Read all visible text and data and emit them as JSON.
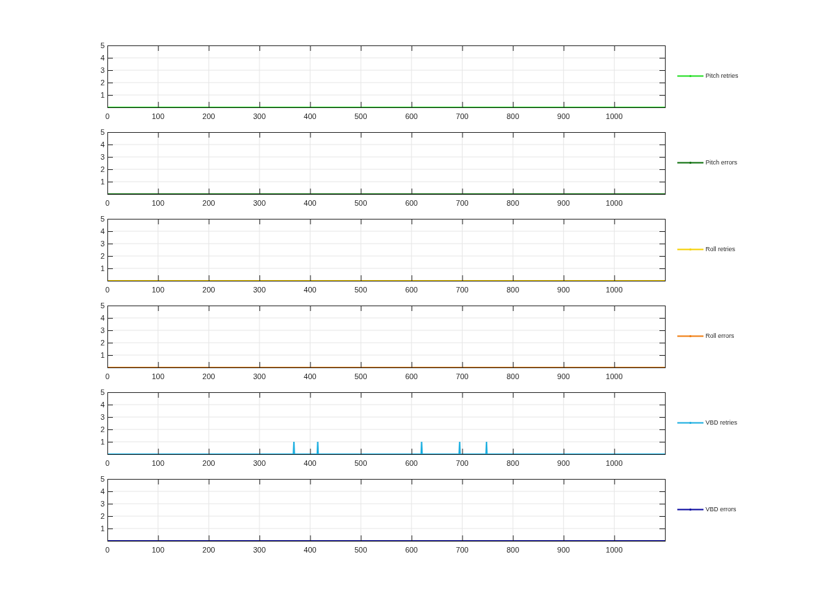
{
  "charts": [
    {
      "chart_data": {
        "type": "line",
        "grid": true,
        "xlim": [
          0,
          1100
        ],
        "ylim": [
          0,
          5
        ],
        "xticks": [
          0,
          100,
          200,
          300,
          400,
          500,
          600,
          700,
          800,
          900,
          1000
        ],
        "yticks": [
          1,
          2,
          3,
          4,
          5
        ],
        "x": [
          0,
          1100
        ],
        "series": [
          {
            "name": "Pitch retries",
            "color": "#22dd22",
            "values": [
              0,
              0
            ]
          }
        ]
      }
    },
    {
      "chart_data": {
        "type": "line",
        "grid": true,
        "xlim": [
          0,
          1100
        ],
        "ylim": [
          0,
          5
        ],
        "xticks": [
          0,
          100,
          200,
          300,
          400,
          500,
          600,
          700,
          800,
          900,
          1000
        ],
        "yticks": [
          1,
          2,
          3,
          4,
          5
        ],
        "x": [
          0,
          1100
        ],
        "series": [
          {
            "name": "Pitch errors",
            "color": "#0b6e0b",
            "values": [
              0,
              0
            ]
          }
        ]
      }
    },
    {
      "chart_data": {
        "type": "line",
        "grid": true,
        "xlim": [
          0,
          1100
        ],
        "ylim": [
          0,
          5
        ],
        "xticks": [
          0,
          100,
          200,
          300,
          400,
          500,
          600,
          700,
          800,
          900,
          1000
        ],
        "yticks": [
          1,
          2,
          3,
          4,
          5
        ],
        "x": [
          0,
          1100
        ],
        "series": [
          {
            "name": "Roll retries",
            "color": "#f5d000",
            "values": [
              0,
              0
            ]
          }
        ]
      }
    },
    {
      "chart_data": {
        "type": "line",
        "grid": true,
        "xlim": [
          0,
          1100
        ],
        "ylim": [
          0,
          5
        ],
        "xticks": [
          0,
          100,
          200,
          300,
          400,
          500,
          600,
          700,
          800,
          900,
          1000
        ],
        "yticks": [
          1,
          2,
          3,
          4,
          5
        ],
        "x": [
          0,
          1100
        ],
        "series": [
          {
            "name": "Roll errors",
            "color": "#f07d10",
            "values": [
              0,
              0
            ]
          }
        ]
      }
    },
    {
      "chart_data": {
        "type": "line",
        "grid": true,
        "xlim": [
          0,
          1100
        ],
        "ylim": [
          0,
          5
        ],
        "xticks": [
          0,
          100,
          200,
          300,
          400,
          500,
          600,
          700,
          800,
          900,
          1000
        ],
        "yticks": [
          1,
          2,
          3,
          4,
          5
        ],
        "x": [
          0,
          367,
          368,
          369,
          414,
          415,
          416,
          619,
          620,
          621,
          694,
          695,
          696,
          747,
          748,
          749,
          1100
        ],
        "series": [
          {
            "name": "VBD retries",
            "color": "#1aaee0",
            "values": [
              0,
              0,
              1,
              0,
              0,
              1,
              0,
              0,
              1,
              0,
              0,
              1,
              0,
              0,
              1,
              0,
              0
            ]
          }
        ]
      }
    },
    {
      "chart_data": {
        "type": "line",
        "grid": true,
        "xlim": [
          0,
          1100
        ],
        "ylim": [
          0,
          5
        ],
        "xticks": [
          0,
          100,
          200,
          300,
          400,
          500,
          600,
          700,
          800,
          900,
          1000
        ],
        "yticks": [
          1,
          2,
          3,
          4,
          5
        ],
        "x": [
          0,
          1100
        ],
        "series": [
          {
            "name": "VBD errors",
            "color": "#0a0aa0",
            "values": [
              0,
              0
            ]
          }
        ]
      }
    }
  ]
}
